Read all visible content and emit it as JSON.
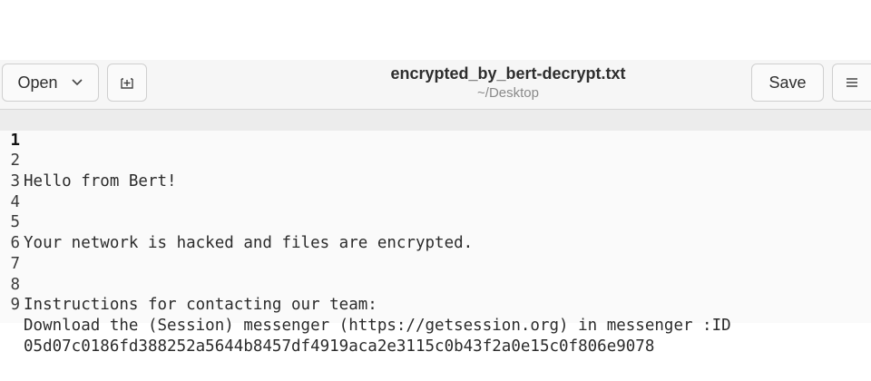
{
  "header": {
    "open_label": "Open",
    "save_label": "Save",
    "title": "encrypted_by_bert-decrypt.txt",
    "subtitle": "~/Desktop"
  },
  "editor": {
    "lines": [
      {
        "num": "1",
        "text": ""
      },
      {
        "num": "2",
        "text": "Hello from Bert!"
      },
      {
        "num": "3",
        "text": ""
      },
      {
        "num": "4",
        "text": ""
      },
      {
        "num": "5",
        "text": "Your network is hacked and files are encrypted."
      },
      {
        "num": "6",
        "text": ""
      },
      {
        "num": "7",
        "text": ""
      },
      {
        "num": "8",
        "text": "Instructions for contacting our team:"
      },
      {
        "num": "9",
        "text": "Download the (Session) messenger (https://getsession.org) in messenger :ID"
      },
      {
        "num": "",
        "text": "05d07c0186fd388252a5644b8457df4919aca2e3115c0b43f2a0e15c0f806e9078"
      }
    ]
  },
  "icons": {
    "open_dropdown": "chevron-down-icon",
    "new_tab": "new-tab-icon",
    "menu": "hamburger-menu-icon"
  }
}
